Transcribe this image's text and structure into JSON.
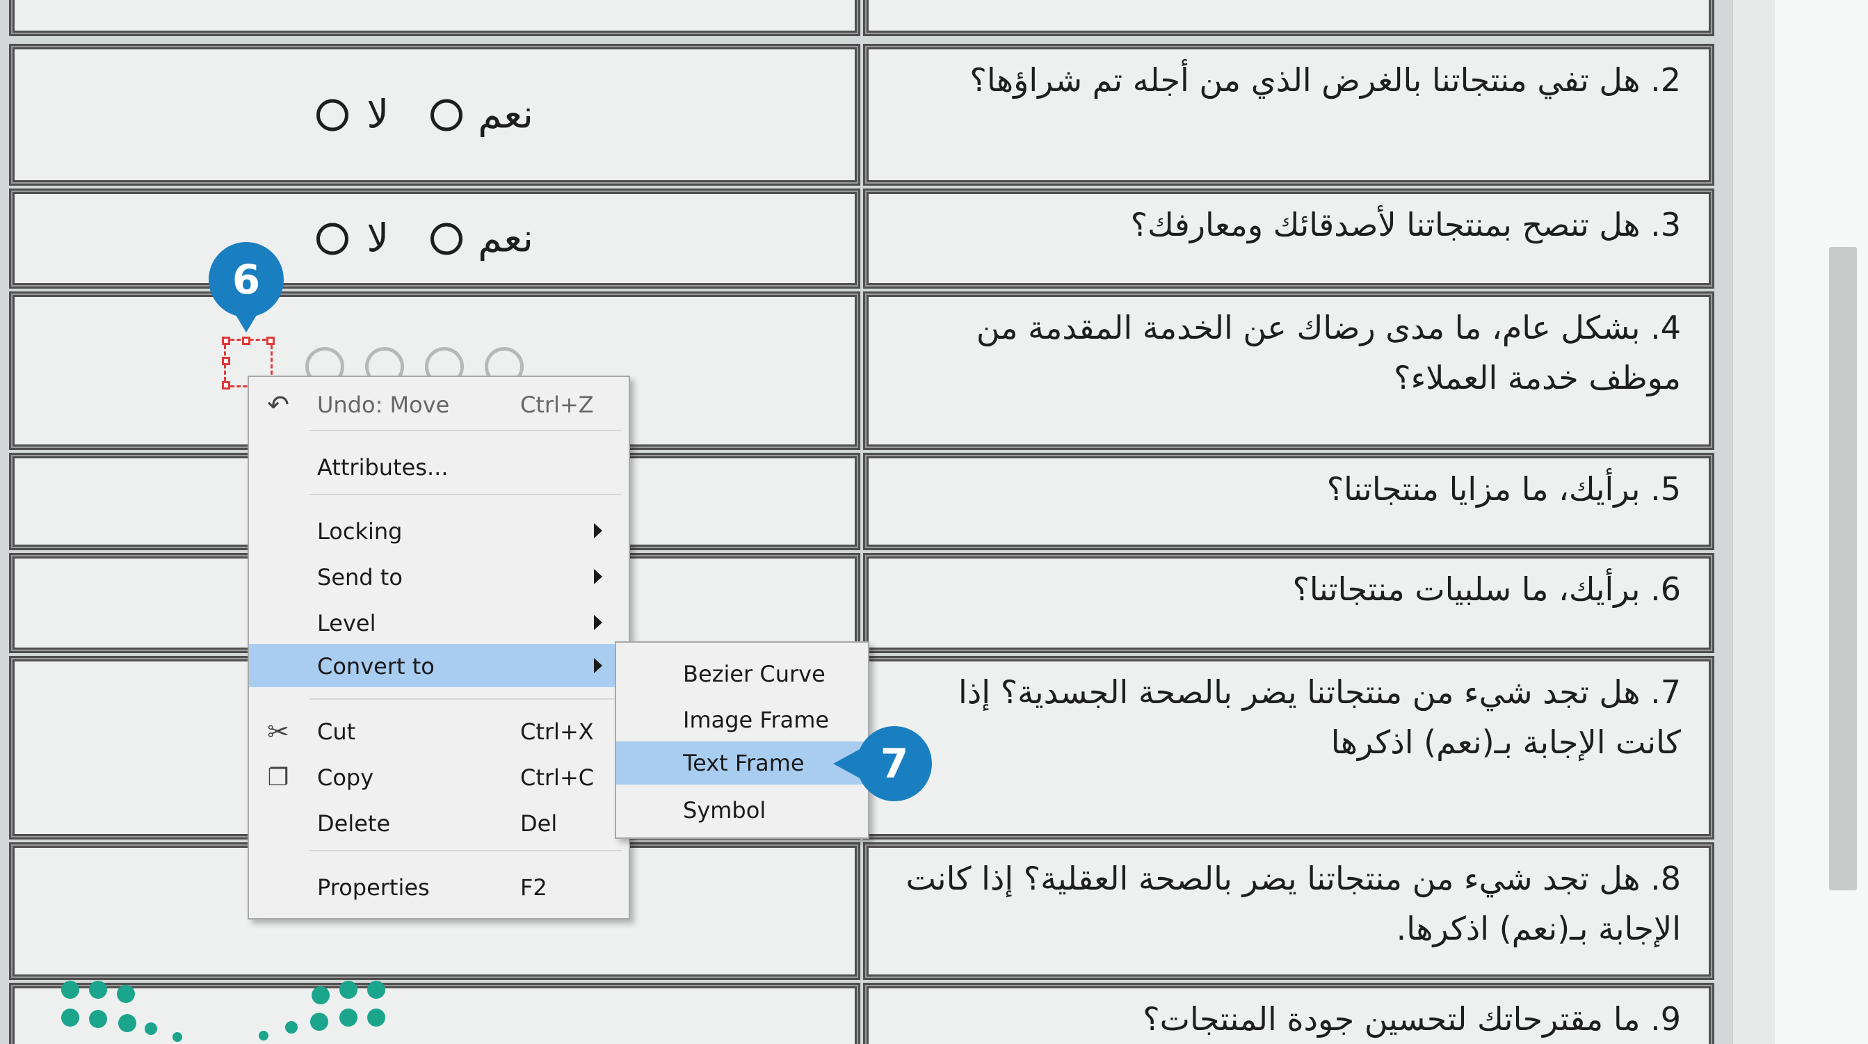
{
  "questions": [
    {
      "id": "q2",
      "text": "2. هل تفي منتجاتنا بالغرض الذي من أجله تم شراؤها؟",
      "answer": "yes-no"
    },
    {
      "id": "q3",
      "text": "3. هل تنصح بمنتجاتنا لأصدقائك ومعارفك؟",
      "answer": "yes-no"
    },
    {
      "id": "q4",
      "text": "4. بشكل عام، ما مدى رضاك عن الخدمة المقدمة من\nموظف خدمة العملاء؟",
      "answer": "rating"
    },
    {
      "id": "q5",
      "text": "5. برأيك، ما مزايا منتجاتنا؟",
      "answer": "text"
    },
    {
      "id": "q6",
      "text": "6. برأيك، ما سلبيات منتجاتنا؟",
      "answer": "text"
    },
    {
      "id": "q7",
      "text": "7. هل تجد شيء من منتجاتنا يضر بالصحة الجسدية؟ إذا\nكانت الإجابة بـ(نعم) اذكرها",
      "answer": "text"
    },
    {
      "id": "q8",
      "text": "8. هل تجد شيء من منتجاتنا يضر بالصحة العقلية؟ إذا كانت\nالإجابة بـ(نعم) اذكرها.",
      "answer": "text"
    },
    {
      "id": "q9",
      "text": "9. ما مقترحاتك لتحسين جودة المنتجات؟",
      "answer": "text"
    }
  ],
  "choices": {
    "yes": "نعم",
    "no": "لا"
  },
  "context_menu": {
    "undo": {
      "label": "Undo: Move",
      "shortcut": "Ctrl+Z"
    },
    "attributes": {
      "label": "Attributes..."
    },
    "locking": {
      "label": "Locking"
    },
    "send_to": {
      "label": "Send to"
    },
    "level": {
      "label": "Level"
    },
    "convert_to": {
      "label": "Convert to"
    },
    "cut": {
      "label": "Cut",
      "shortcut": "Ctrl+X"
    },
    "copy": {
      "label": "Copy",
      "shortcut": "Ctrl+C"
    },
    "delete": {
      "label": "Delete",
      "shortcut": "Del"
    },
    "properties": {
      "label": "Properties",
      "shortcut": "F2"
    }
  },
  "convert_submenu": {
    "bezier_curve": "Bezier Curve",
    "image_frame": "Image Frame",
    "text_frame": "Text Frame",
    "symbol": "Symbol"
  },
  "callouts": {
    "step6": "6",
    "step7": "7"
  },
  "icons": {
    "undo": "undo-icon",
    "cut": "scissors-icon",
    "copy": "copy-icon",
    "submenu": "chevron-right-icon"
  },
  "colors": {
    "callout": "#1a7fc1",
    "menu_highlight": "#a9cdf0",
    "selection": "#e03a3a",
    "logo": "#1aa58c"
  }
}
